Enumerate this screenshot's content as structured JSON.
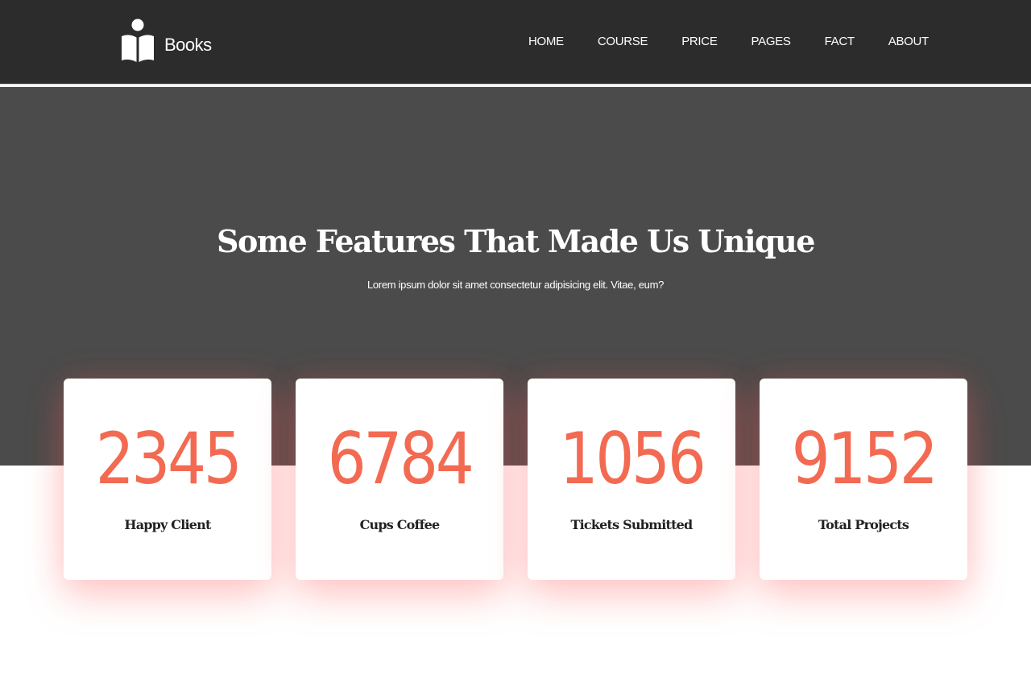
{
  "brand": {
    "name": "Books",
    "icon": "book-reader-icon"
  },
  "nav": {
    "items": [
      {
        "label": "HOME"
      },
      {
        "label": "COURSE"
      },
      {
        "label": "PRICE"
      },
      {
        "label": "PAGES"
      },
      {
        "label": "FACT"
      },
      {
        "label": "ABOUT"
      }
    ]
  },
  "hero": {
    "title": "Some Features That Made Us Unique",
    "subtitle": "Lorem ipsum dolor sit amet consectetur adipisicing elit. Vitae, eum?"
  },
  "stats": [
    {
      "value": "2345",
      "label": "Happy Client"
    },
    {
      "value": "6784",
      "label": "Cups Coffee"
    },
    {
      "value": "1056",
      "label": "Tickets Submitted"
    },
    {
      "value": "9152",
      "label": "Total Projects"
    }
  ],
  "colors": {
    "header_bg": "#2c2c2c",
    "hero_bg": "#4b4b4b",
    "accent": "#f36a52",
    "text_light": "#ffffff",
    "text_dark": "#222222"
  }
}
